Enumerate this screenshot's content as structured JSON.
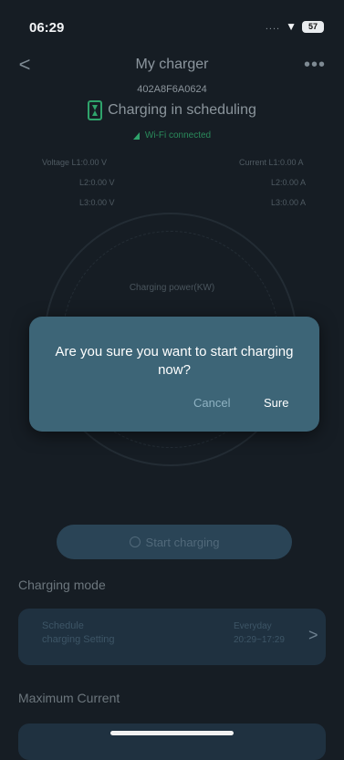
{
  "status_bar": {
    "time": "06:29",
    "signal_dots": "....",
    "wifi_glyph": "▼",
    "battery": "57"
  },
  "header": {
    "back_glyph": "<",
    "title": "My charger",
    "more_glyph": "•••"
  },
  "charger": {
    "serial": "402A8F6A0624",
    "status": "Charging in scheduling",
    "wifi_status": "Wi-Fi connected",
    "voltage_l1": "Voltage L1:0.00 V",
    "voltage_l2": "L2:0.00 V",
    "voltage_l3": "L3:0.00 V",
    "current_l1": "Current L1:0.00 A",
    "current_l2": "L2:0.00 A",
    "current_l3": "L3:0.00 A",
    "gauge_label": "Charging power(KW)"
  },
  "start_button": {
    "label": "Start charging"
  },
  "charging_mode": {
    "title": "Charging mode",
    "line1": "Schedule",
    "line2": "charging Setting",
    "days": "Everyday",
    "time_range": "20:29~17:29",
    "chevron": ">"
  },
  "max_current": {
    "title": "Maximum Current"
  },
  "dialog": {
    "message": "Are you sure you want to start charging now?",
    "cancel": "Cancel",
    "sure": "Sure"
  },
  "colors": {
    "background": "#161d24",
    "dialog": "#3d6577",
    "accent_green": "#2fa36b",
    "card": "#1f3140"
  }
}
